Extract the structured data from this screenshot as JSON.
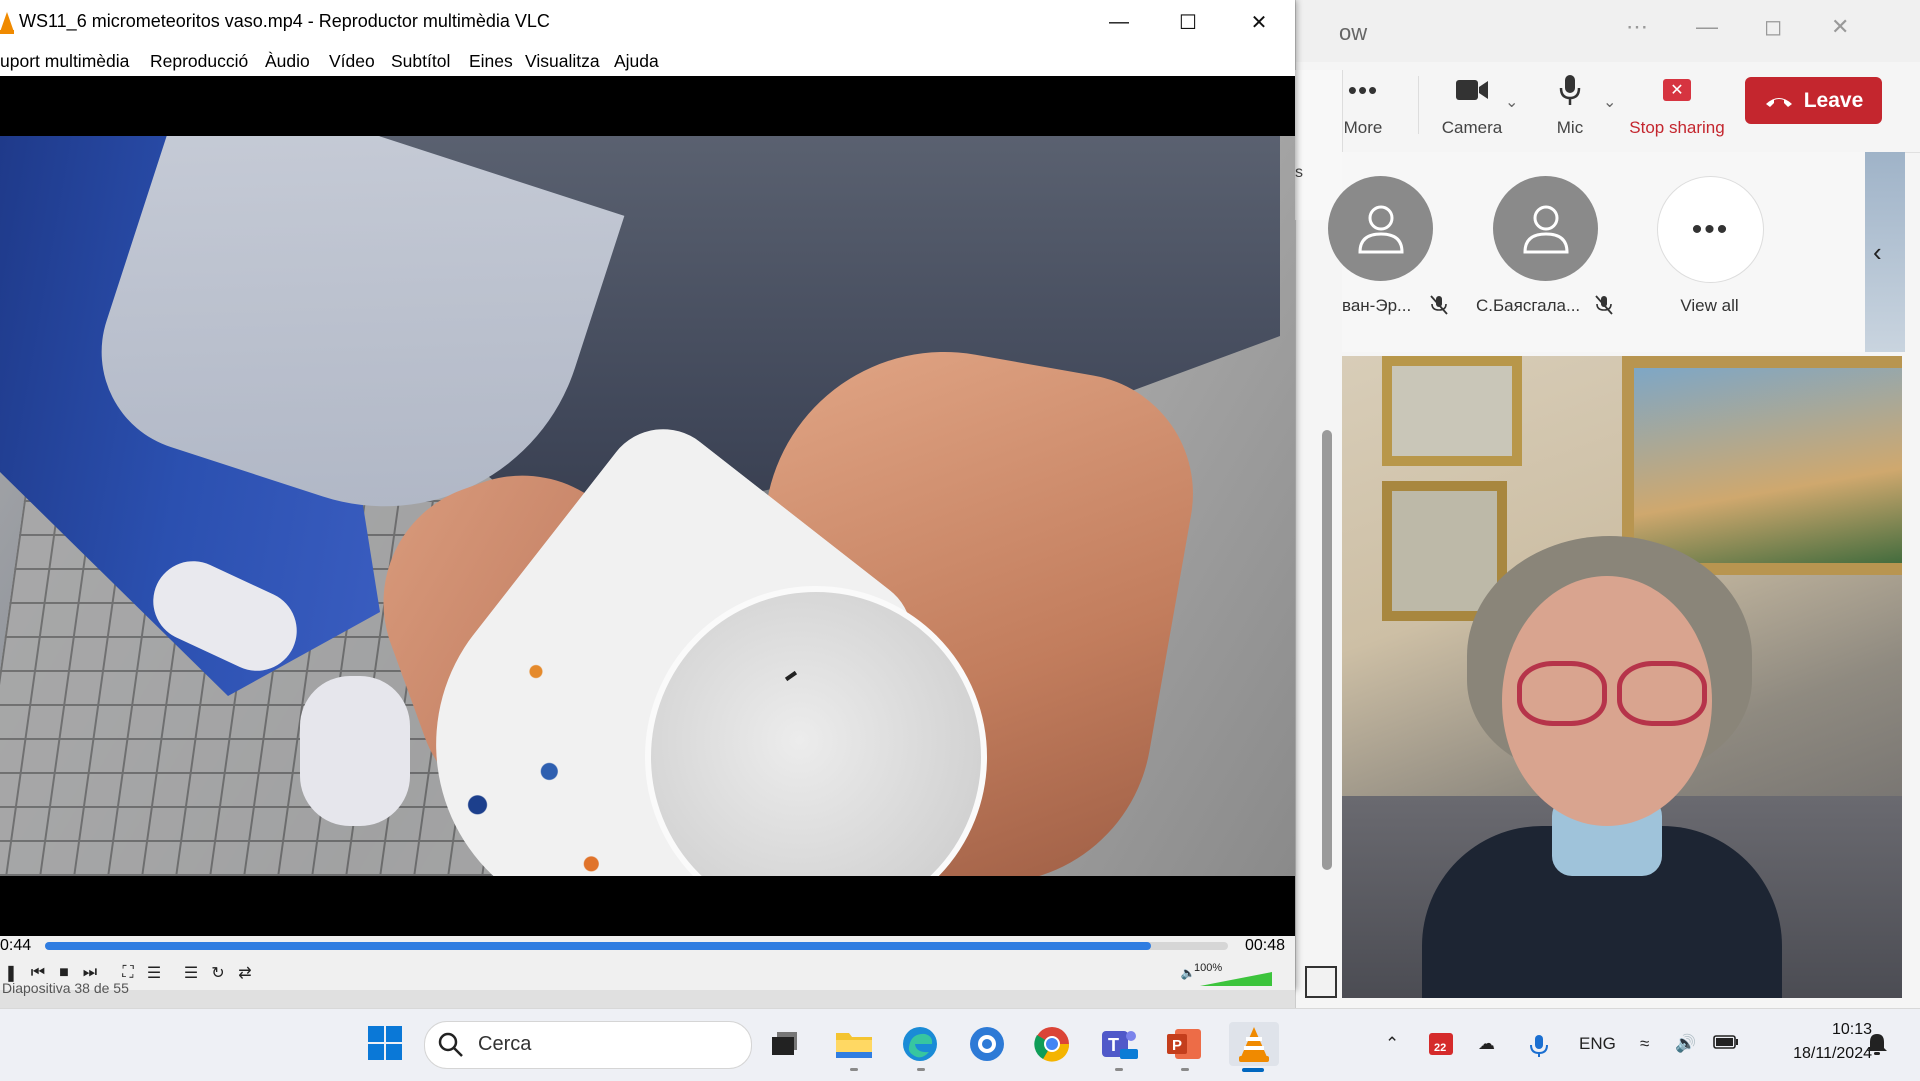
{
  "vlc": {
    "title": "WS11_6 micrometeoritos vaso.mp4 - Reproductor multimèdia VLC",
    "menu": [
      "uport multimèdia",
      "Reproducció",
      "Àudio",
      "Vídeo",
      "Subtítol",
      "Eines",
      "Visualitza",
      "Ajuda"
    ],
    "time_elapsed": "0:44",
    "time_total": "00:48",
    "progress": 0.935,
    "volume_label": "100%",
    "volume_level": 1.0,
    "status_text": "Diapositiva 38 de 55"
  },
  "teams": {
    "title_fragment": "ow",
    "toolbar": {
      "more": "More",
      "camera": "Camera",
      "mic": "Mic",
      "stop_sharing": "Stop sharing",
      "leave": "Leave"
    },
    "participants": [
      {
        "name": "ван-Эр..."
      },
      {
        "name": "С.Баясгала..."
      }
    ],
    "view_all": "View all",
    "side_fragment": "s"
  },
  "taskbar": {
    "search_placeholder": "Cerca",
    "language": "ENG",
    "calendar_badge": "22",
    "time": "10:13",
    "date": "18/11/2024"
  },
  "colors": {
    "leave_red": "#c4262e",
    "seek_blue": "#2f7de1",
    "vlc_orange": "#f08a00"
  }
}
